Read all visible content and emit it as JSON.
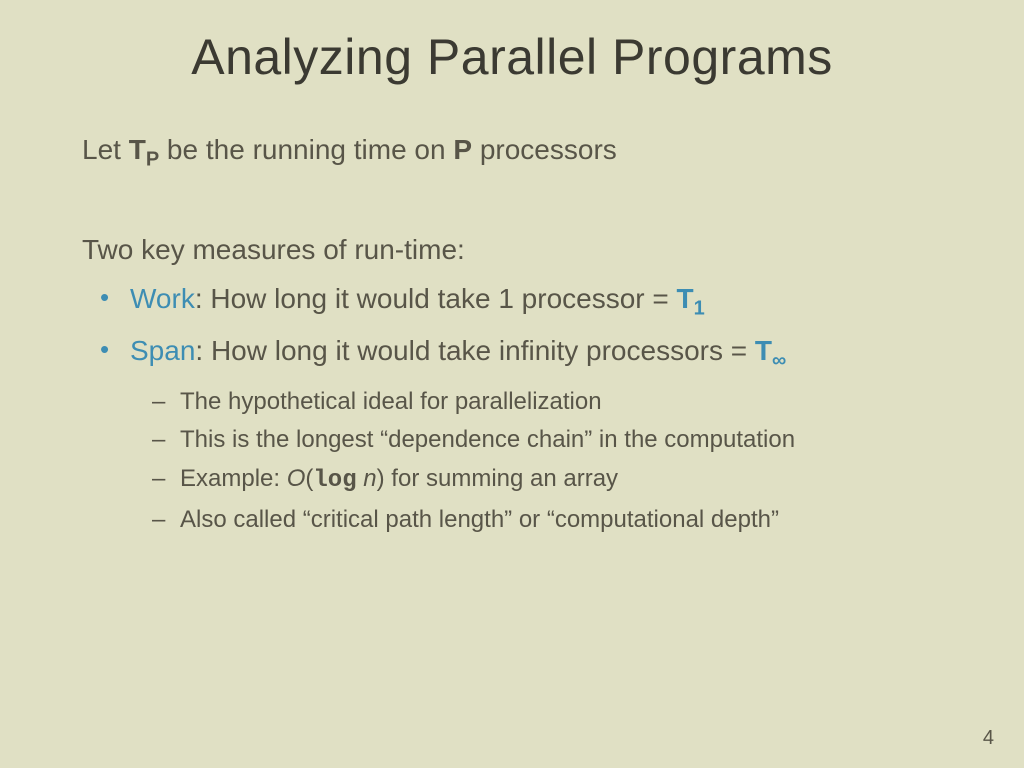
{
  "title": "Analyzing Parallel Programs",
  "line1": {
    "pre": "Let ",
    "t": "T",
    "sub": "P",
    "mid": " be the running time on ",
    "p": "P",
    "post": " processors"
  },
  "intro": "Two key measures of run-time:",
  "bullets": [
    {
      "term": "Work",
      "rest": ": How long it would take 1 processor = ",
      "tvar": "T",
      "tsub": "1"
    },
    {
      "term": "Span",
      "rest": ": How long it would take infinity processors = ",
      "tvar": "T",
      "tsub": "∞"
    }
  ],
  "sub": [
    "The hypothetical ideal for parallelization",
    "This is the longest “dependence chain” in the computation"
  ],
  "sub_ex": {
    "pre": "Example: ",
    "o": "O",
    "open": "(",
    "log": "log",
    "space": " ",
    "n": "n",
    "close": ")",
    "post": " for summing an array"
  },
  "sub_last": "Also called “critical path length” or “computational depth”",
  "pagenum": "4"
}
